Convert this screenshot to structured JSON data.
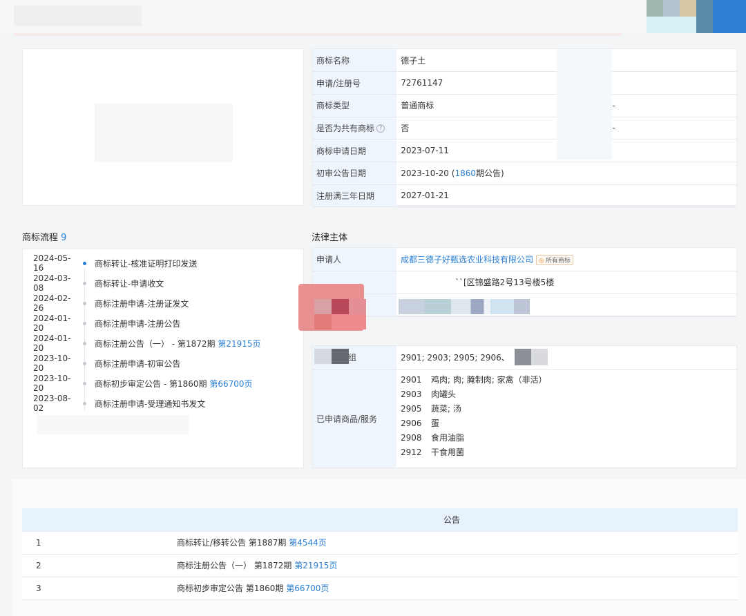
{
  "trademark_info": {
    "rows": [
      {
        "label": "商标名称",
        "value": "德子土",
        "extra": ""
      },
      {
        "label": "申请/注册号",
        "value": "72761147",
        "extra": ""
      },
      {
        "label": "商标类型",
        "value": "普通商标",
        "extra": "-"
      },
      {
        "label": "是否为共有商标",
        "value": "否",
        "extra": "-",
        "help": "?"
      },
      {
        "label": "商标申请日期",
        "value": "2023-07-11",
        "extra": ""
      },
      {
        "label": "初审公告日期",
        "value": "2023-10-20",
        "issue": "1860",
        "issue_suffix": "期公告)",
        "issue_prefix": "(",
        "extra": ""
      },
      {
        "label": "注册满三年日期",
        "value": "2027-01-21",
        "extra": ""
      }
    ]
  },
  "flow": {
    "title": "商标流程",
    "count": "9",
    "items": [
      {
        "date": "2024-05-16",
        "text": "商标转让-核准证明打印发送",
        "active": true
      },
      {
        "date": "2024-03-08",
        "text": "商标转让-申请收文"
      },
      {
        "date": "2024-02-26",
        "text": "商标注册申请-注册证发文"
      },
      {
        "date": "2024-01-20",
        "text": "商标注册申请-注册公告"
      },
      {
        "date": "2024-01-20",
        "text": "商标注册公告（一） - 第1872期",
        "link": "第21915页"
      },
      {
        "date": "2023-10-20",
        "text": "商标注册申请-初审公告"
      },
      {
        "date": "2023-10-20",
        "text": "商标初步审定公告 - 第1860期",
        "link": "第66700页"
      },
      {
        "date": "2023-08-02",
        "text": "商标注册申请-受理通知书发文"
      }
    ]
  },
  "legal": {
    "title": "法律主体",
    "applicant_label": "申请人",
    "applicant_name": "成都三德子好甄选农业科技有限公司",
    "applicant_tag": "所有商标",
    "address": "``[区锦盛路2号13号楼5楼",
    "group_label_partial": "群组",
    "group_value": "2901; 2903; 2905; 2906、",
    "goods_label": "已申请商品/服务",
    "goods": [
      {
        "code": "2901",
        "name": "鸡肉; 肉; 腌制肉; 家禽（非活）"
      },
      {
        "code": "2903",
        "name": "肉罐头"
      },
      {
        "code": "2905",
        "name": "蔬菜; 汤"
      },
      {
        "code": "2906",
        "name": "蛋"
      },
      {
        "code": "2908",
        "name": "食用油脂"
      },
      {
        "code": "2912",
        "name": "干食用菌"
      }
    ]
  },
  "announcements": {
    "header": "公告",
    "rows": [
      {
        "num": "1",
        "text": "商标转让/移转公告 第1887期",
        "link": "第4544页"
      },
      {
        "num": "2",
        "text": "商标注册公告（一） 第1872期",
        "link": "第21915页"
      },
      {
        "num": "3",
        "text": "商标初步审定公告 第1860期",
        "link": "第66700页"
      }
    ]
  },
  "colors": {
    "accent": "#2a7fd4",
    "label_bg": "#eef5fc"
  }
}
